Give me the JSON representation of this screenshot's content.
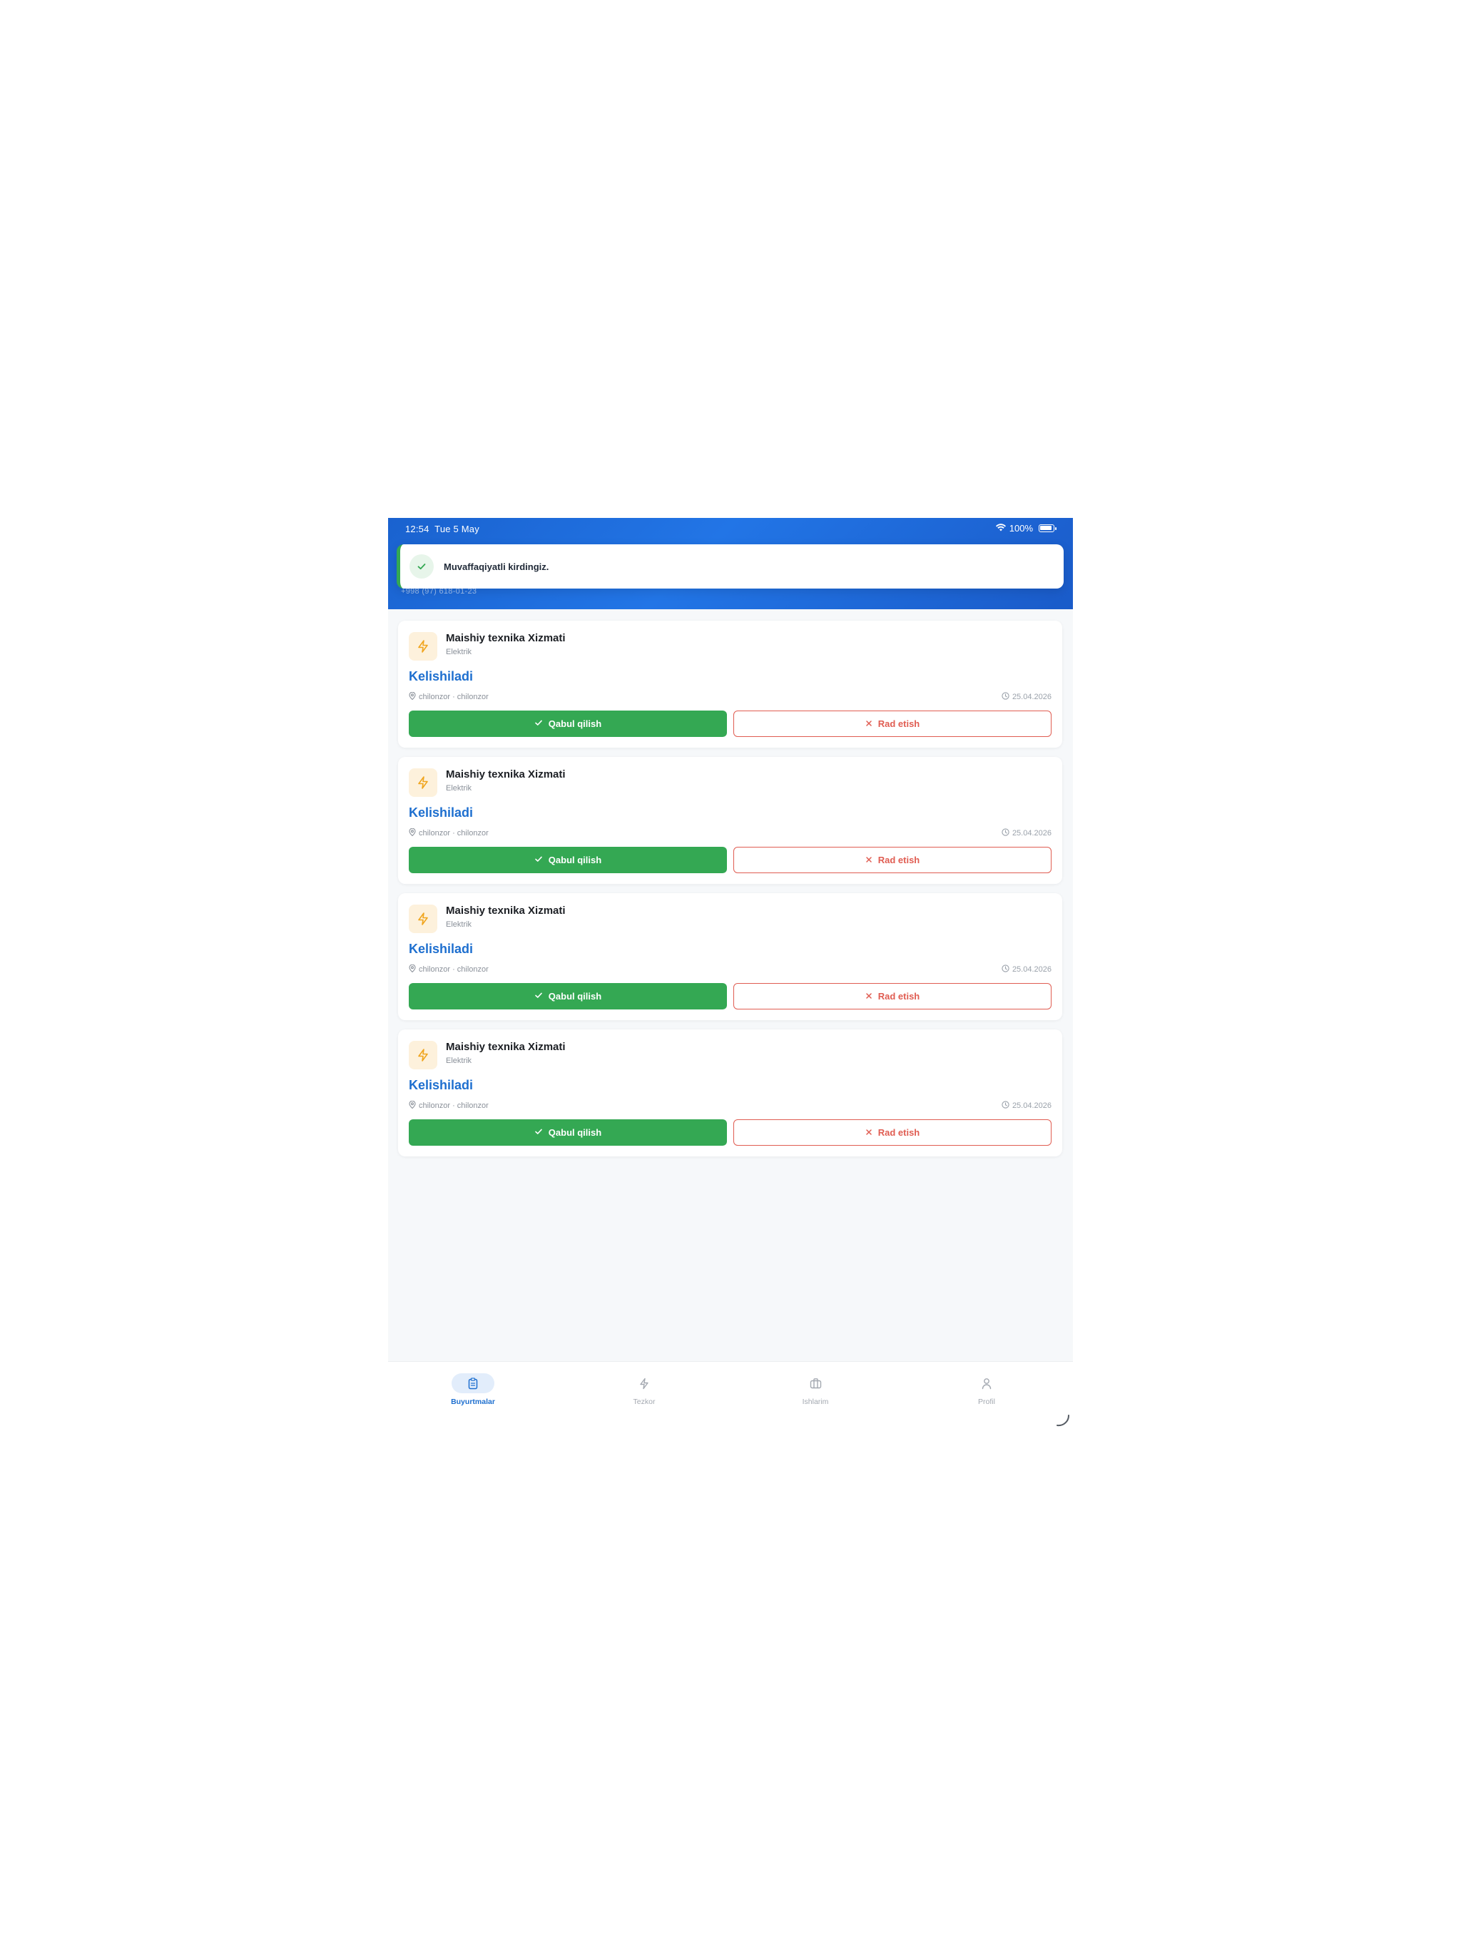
{
  "status_bar": {
    "time": "12:54",
    "date": "Tue 5 May",
    "battery": "100%"
  },
  "header": {
    "phone": "+998 (97) 618-01-23"
  },
  "toast": {
    "message": "Muvaffaqiyatli kirdingiz.",
    "icon": "check-icon"
  },
  "orders": [
    {
      "service_name": "Maishiy texnika Xizmati",
      "category": "Elektrik",
      "price": "Kelishiladi",
      "location": "chilonzor · chilonzor",
      "date": "25.04.2026",
      "accept_label": "Qabul qilish",
      "reject_label": "Rad etish"
    },
    {
      "service_name": "Maishiy texnika Xizmati",
      "category": "Elektrik",
      "price": "Kelishiladi",
      "location": "chilonzor · chilonzor",
      "date": "25.04.2026",
      "accept_label": "Qabul qilish",
      "reject_label": "Rad etish"
    },
    {
      "service_name": "Maishiy texnika Xizmati",
      "category": "Elektrik",
      "price": "Kelishiladi",
      "location": "chilonzor · chilonzor",
      "date": "25.04.2026",
      "accept_label": "Qabul qilish",
      "reject_label": "Rad etish"
    },
    {
      "service_name": "Maishiy texnika Xizmati",
      "category": "Elektrik",
      "price": "Kelishiladi",
      "location": "chilonzor · chilonzor",
      "date": "25.04.2026",
      "accept_label": "Qabul qilish",
      "reject_label": "Rad etish"
    }
  ],
  "bottom_nav": [
    {
      "label": "Buyurtmalar",
      "icon": "clipboard-icon",
      "active": true
    },
    {
      "label": "Tezkor",
      "icon": "lightning-icon",
      "active": false
    },
    {
      "label": "Ishlarim",
      "icon": "briefcase-icon",
      "active": false
    },
    {
      "label": "Profil",
      "icon": "person-icon",
      "active": false
    }
  ],
  "colors": {
    "header_blue": "#1a62cf",
    "accent_blue": "#1e6fcf",
    "accept_green": "#34a853",
    "reject_red": "#e05d52",
    "category_icon_orange": "#f0a51e"
  }
}
